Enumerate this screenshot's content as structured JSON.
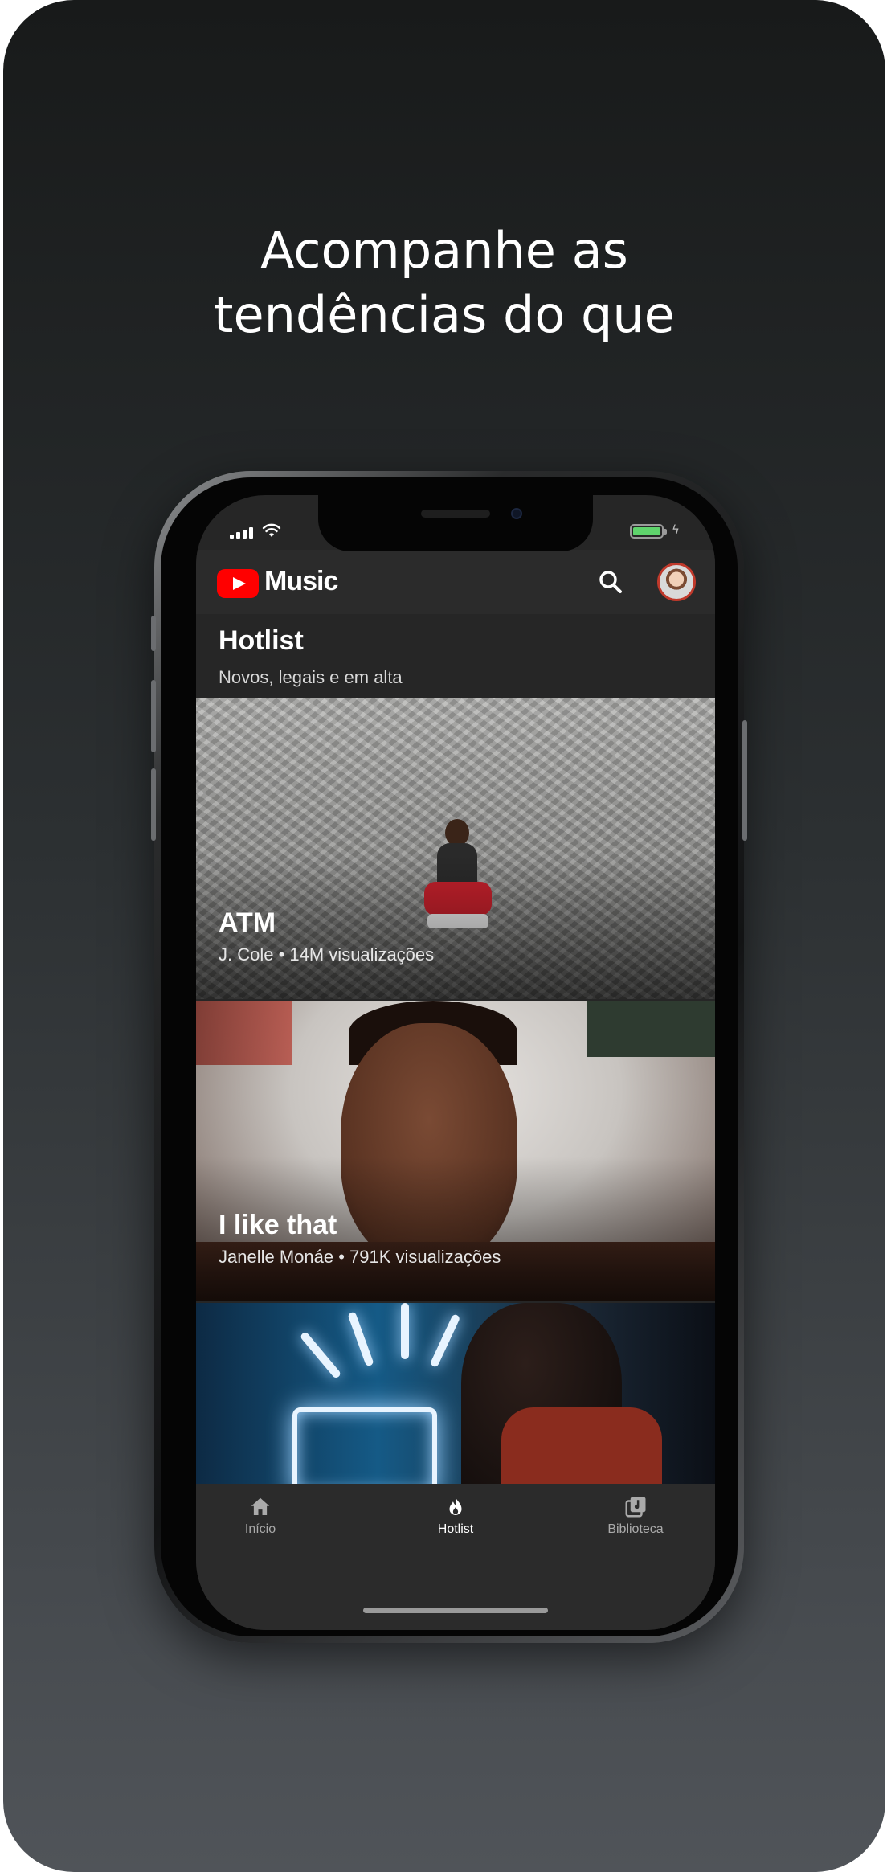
{
  "headline": {
    "line1": "Acompanhe as",
    "line2": "tendências do que"
  },
  "appbar": {
    "app_name": "Music",
    "icons": [
      "youtube-logo-icon",
      "search-icon",
      "avatar"
    ]
  },
  "section": {
    "title": "Hotlist",
    "subtitle": "Novos, legais e em alta"
  },
  "videos": [
    {
      "title": "ATM",
      "meta": "J. Cole • 14M visualizações"
    },
    {
      "title": "I like that",
      "meta": "Janelle Monáe • 791K visualizações"
    },
    {
      "title": "",
      "meta": ""
    }
  ],
  "tabs": [
    {
      "label": "Início",
      "icon": "home-icon",
      "active": false
    },
    {
      "label": "Hotlist",
      "icon": "flame-icon",
      "active": true
    },
    {
      "label": "Biblioteca",
      "icon": "library-icon",
      "active": false
    }
  ],
  "colors": {
    "accent": "#ff0000",
    "battery": "#5fd36c",
    "background_top": "#181a1a",
    "background_bottom": "#505459"
  }
}
